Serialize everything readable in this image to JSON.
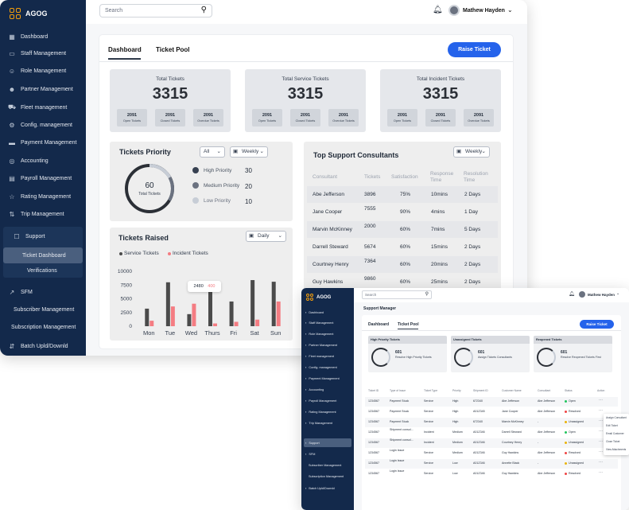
{
  "app": {
    "logo_text": "AGOG",
    "accent": "#2563eb",
    "sidebar_bg": "#13294b",
    "logo_color": "#f59e0b"
  },
  "sidebar": {
    "items": [
      {
        "label": "Dashboard",
        "icon": "grid-icon"
      },
      {
        "label": "Staff Management",
        "icon": "briefcase-icon"
      },
      {
        "label": "Role Management",
        "icon": "user-role-icon"
      },
      {
        "label": "Partner Management",
        "icon": "users-icon"
      },
      {
        "label": "Fleet management",
        "icon": "truck-icon"
      },
      {
        "label": "Config. management",
        "icon": "gear-icon"
      },
      {
        "label": "Payment Management",
        "icon": "card-icon"
      },
      {
        "label": "Accounting",
        "icon": "coin-icon"
      },
      {
        "label": "Payroll Management",
        "icon": "document-icon"
      },
      {
        "label": "Rating Management",
        "icon": "star-icon"
      },
      {
        "label": "Trip Management",
        "icon": "route-icon"
      },
      {
        "label": "Support",
        "icon": "chat-icon"
      },
      {
        "label": "SFM",
        "icon": "trend-icon"
      },
      {
        "label": "Batch Upld/Downld",
        "icon": "updown-icon"
      }
    ],
    "support_sub": [
      "Ticket Dashboard",
      "Verifications"
    ],
    "sfm_sub": [
      "Subscriber Management",
      "Subscription Management"
    ]
  },
  "topbar": {
    "search_placeholder": "Search",
    "user_name": "Mathew Hayden"
  },
  "tabs": {
    "dashboard": "Dashboard",
    "ticket_pool": "Ticket Pool"
  },
  "raise_button": "Raise Ticket",
  "stats": [
    {
      "title": "Total Tickets",
      "value": "3315",
      "sub": [
        {
          "n": "2091",
          "l": "Open Tickets"
        },
        {
          "n": "2091",
          "l": "Closed Tickets"
        },
        {
          "n": "2091",
          "l": "Overdue Tickets"
        }
      ]
    },
    {
      "title": "Total Service Tickets",
      "value": "3315",
      "sub": [
        {
          "n": "2091",
          "l": "Open Tickets"
        },
        {
          "n": "2091",
          "l": "Closed Tickets"
        },
        {
          "n": "2091",
          "l": "Overdue Tickets"
        }
      ]
    },
    {
      "title": "Total Incident Tickets",
      "value": "3315",
      "sub": [
        {
          "n": "2091",
          "l": "Open Tickets"
        },
        {
          "n": "2091",
          "l": "Closed Tickets"
        },
        {
          "n": "2091",
          "l": "Overdue Tickets"
        }
      ]
    }
  ],
  "priority": {
    "title": "Tickets Priority",
    "filter_all": "All",
    "filter_period": "Weekly",
    "total": "60",
    "total_label": "Total Tickets",
    "levels": [
      {
        "label": "High Priority",
        "value": "30",
        "color": "#374151"
      },
      {
        "label": "Medium Priority",
        "value": "20",
        "color": "#6b7280"
      },
      {
        "label": "Low Priority",
        "value": "10",
        "color": "#c7cdd6"
      }
    ]
  },
  "raised": {
    "title": "Tickets Raised",
    "filter_period": "Daily",
    "tooltip": {
      "a": "2480",
      "b": "400"
    },
    "chart_data": {
      "type": "bar",
      "categories": [
        "Mon",
        "Tue",
        "Wed",
        "Thurs",
        "Fri",
        "Sat",
        "Sun"
      ],
      "series": [
        {
          "name": "Service Tickets",
          "color": "#4b4b4b",
          "values": [
            3200,
            8000,
            2200,
            7400,
            4500,
            8400,
            8100
          ]
        },
        {
          "name": "Incident Tickets",
          "color": "#f47c82",
          "values": [
            1000,
            3600,
            4100,
            500,
            800,
            1200,
            4500
          ]
        }
      ],
      "y_ticks": [
        "10000",
        "7500",
        "5000",
        "2500",
        "0"
      ],
      "ylim": [
        0,
        10000
      ]
    }
  },
  "consultants": {
    "title": "Top Support Consultants",
    "filter_period": "Weekly",
    "headers": [
      "Consultant",
      "Tickets",
      "Satisfaction",
      "Response Time",
      "Resolution Time"
    ],
    "rows": [
      [
        "Abe Jefferson",
        "3896",
        "75%",
        "10mins",
        "2 Days"
      ],
      [
        "Jane Cooper",
        "7555",
        "90%",
        "4mins",
        "1 Day"
      ],
      [
        "Marvin McKinney",
        "2000",
        "60%",
        "7mins",
        "5 Days"
      ],
      [
        "Darrell Steward",
        "5674",
        "60%",
        "15mins",
        "2 Days"
      ],
      [
        "Courtney Henry",
        "7364",
        "60%",
        "20mins",
        "2 Days"
      ],
      [
        "Guy Hawkins",
        "9860",
        "60%",
        "25mins",
        "2 Days"
      ]
    ]
  },
  "w2": {
    "page_title": "Support Manager",
    "search_placeholder": "Search",
    "user_name": "Mathew Hayden",
    "tabs": {
      "dashboard": "Dashboard",
      "ticket_pool": "Ticket Pool"
    },
    "raise_button": "Raise Ticket",
    "cards": [
      {
        "title": "High Priority Tickets",
        "num": "601",
        "text": "Resolve High Priority Tickets"
      },
      {
        "title": "Unassigned Tickets",
        "num": "601",
        "text": "Assign Tickets Consultants"
      },
      {
        "title": "Reopened Tickets",
        "num": "601",
        "text": "Resolve Reopened Tickets First"
      }
    ],
    "headers": [
      "Ticket ID",
      "Type of Issue",
      "Ticket Type",
      "Priority",
      "Shipment ID",
      "Customer Name",
      "Consultant",
      "Status",
      "Action"
    ],
    "rows": [
      [
        "1234567",
        "Payment Stuck",
        "Service",
        "High",
        "672340",
        "Abe Jefferson",
        "Abe Jefferson",
        "Open",
        "green"
      ],
      [
        "1234567",
        "Payment Stuck",
        "Service",
        "High",
        "A01Z345",
        "Jane Cooper",
        "Abe Jefferson",
        "Resolved",
        "red"
      ],
      [
        "1234567",
        "Payment Stuck",
        "Service",
        "High",
        "672340",
        "Marvin McKinney",
        "-",
        "Unassigned",
        "yellow"
      ],
      [
        "1234567",
        "Shipment consol...",
        "Incident",
        "Medium",
        "A01Z346",
        "Darrell Steward",
        "Abe Jefferson",
        "Open",
        "green"
      ],
      [
        "1234567",
        "Shipment consol...",
        "Incident",
        "Medium",
        "A01Z346",
        "Courtney Henry",
        "-",
        "Unassigned",
        "yellow"
      ],
      [
        "1234567",
        "Login Issue",
        "Service",
        "Medium",
        "A01Z346",
        "Guy Hawkins",
        "Abe Jefferson",
        "Resolved",
        "red"
      ],
      [
        "1234567",
        "Login Issue",
        "Service",
        "Low",
        "A01Z346",
        "Annette Black",
        "-",
        "Unassigned",
        "yellow"
      ],
      [
        "1234567",
        "Login Issue",
        "Service",
        "Low",
        "A01Z346",
        "Guy Hawkins",
        "Abe Jefferson",
        "Resolved",
        "red"
      ]
    ],
    "action_menu": [
      "Assign Consultant",
      "Edit Ticket",
      "Email Customer",
      "Close Ticket",
      "View Attachments"
    ],
    "sidebar_items": [
      "Dashboard",
      "Staff Management",
      "Role Management",
      "Partner Management",
      "Fleet management",
      "Config. management",
      "Payment Management",
      "Accounting",
      "Payroll Management",
      "Rating Management",
      "Trip Management",
      "Support",
      "SFM",
      "Subscriber Management",
      "Subscription Management",
      "Batch Upld/Downld"
    ]
  }
}
